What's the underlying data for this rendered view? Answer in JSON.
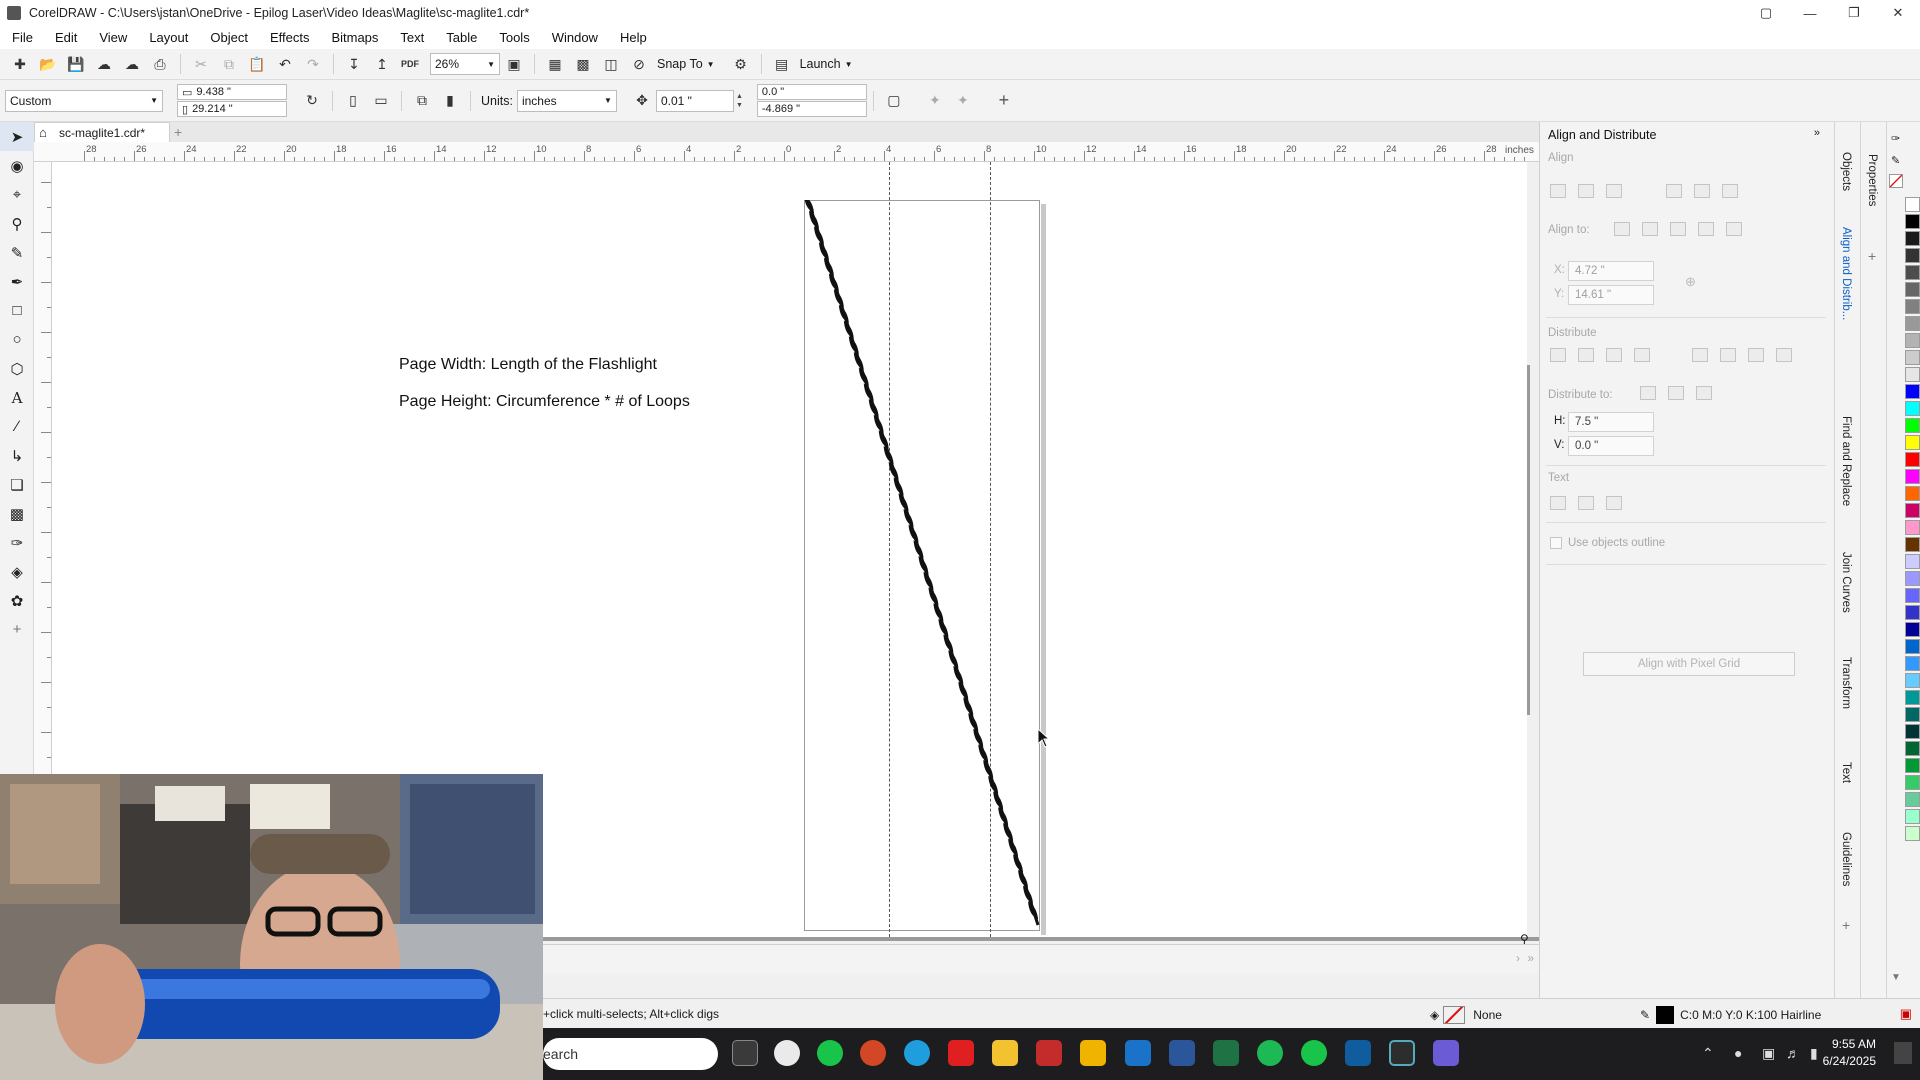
{
  "window": {
    "title": "CorelDRAW - C:\\Users\\jstan\\OneDrive - Epilog Laser\\Video Ideas\\Maglite\\sc-maglite1.cdr*"
  },
  "menu": [
    "File",
    "Edit",
    "View",
    "Layout",
    "Object",
    "Effects",
    "Bitmaps",
    "Text",
    "Table",
    "Tools",
    "Window",
    "Help"
  ],
  "toolbar1": {
    "zoom_value": "26%",
    "snap_label": "Snap To",
    "launch_label": "Launch"
  },
  "toolbar2": {
    "page_preset": "Custom",
    "page_width": "9.438 \"",
    "page_height": "29.214 \"",
    "units_label": "Units:",
    "units_value": "inches",
    "nudge_value": "0.01 \"",
    "dup_x": "0.0 \"",
    "dup_y": "-4.869 \""
  },
  "document": {
    "tab_name": "sc-maglite1.cdr*",
    "ruler_unit": "inches",
    "ruler_labels": [
      "28",
      "26",
      "24",
      "22",
      "20",
      "18",
      "16",
      "14",
      "12",
      "10",
      "8",
      "6",
      "4",
      "2",
      "0",
      "2",
      "4",
      "6",
      "8",
      "10",
      "12",
      "14",
      "16",
      "18",
      "20",
      "22",
      "24",
      "26",
      "28"
    ],
    "notes": [
      "Page Width: Length of the Flashlight",
      "Page Height: Circumference * # of Loops"
    ]
  },
  "docker": {
    "title": "Align and Distribute",
    "align_heading": "Align",
    "align_to_label": "Align to:",
    "x_label": "X:",
    "x_value": "4.72 \"",
    "y_label": "Y:",
    "y_value": "14.61 \"",
    "distribute_heading": "Distribute",
    "distribute_to_label": "Distribute to:",
    "h_label": "H:",
    "h_value": "7.5 \"",
    "v_label": "V:",
    "v_value": "0.0 \"",
    "text_heading": "Text",
    "use_outline_label": "Use objects outline",
    "pixel_grid_label": "Align with Pixel Grid"
  },
  "side_tabs": [
    "Objects",
    "Align and Distrib...",
    "Find and Replace",
    "Join Curves",
    "Transform",
    "Text",
    "Guidelines"
  ],
  "side_tab_properties": "Properties",
  "status": {
    "hint": "+click multi-selects; Alt+click digs",
    "fill_label": "None",
    "outline_label": "C:0 M:0 Y:0 K:100  Hairline"
  },
  "taskbar": {
    "search_placeholder": "earch",
    "time": "9:55 AM",
    "date": "6/24/2025"
  },
  "colors": {
    "accent": "#0a5fc7",
    "palette": [
      "#ffffff",
      "#000000",
      "#1a1a1a",
      "#333333",
      "#4d4d4d",
      "#666666",
      "#808080",
      "#999999",
      "#b3b3b3",
      "#cccccc",
      "#e6e6e6",
      "#0000ff",
      "#00ffff",
      "#00ff00",
      "#ffff00",
      "#ff0000",
      "#ff00ff",
      "#ff6600",
      "#cc0066",
      "#ff99cc",
      "#663300",
      "#ccccff",
      "#9999ff",
      "#6666ff",
      "#3333cc",
      "#000099",
      "#0066cc",
      "#3399ff",
      "#66ccff",
      "#009999",
      "#006666",
      "#003333",
      "#006633",
      "#009933",
      "#33cc66",
      "#66cc99",
      "#99ffcc",
      "#ccffcc"
    ]
  }
}
